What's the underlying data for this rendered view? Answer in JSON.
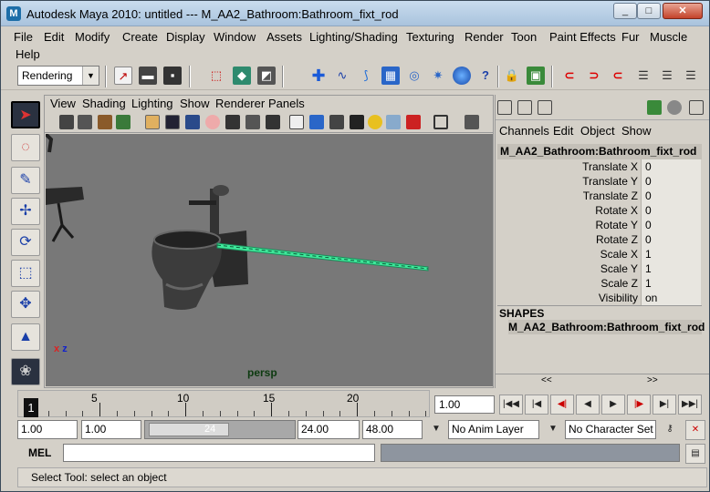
{
  "window": {
    "title": "Autodesk Maya 2010: untitled   ---   M_AA2_Bathroom:Bathroom_fixt_rod"
  },
  "menubar": {
    "items": [
      "File",
      "Edit",
      "Modify",
      "Create",
      "Display",
      "Window",
      "Assets",
      "Lighting/Shading",
      "Texturing",
      "Render",
      "Toon",
      "Paint Effects",
      "Fur",
      "Muscle",
      "Help"
    ]
  },
  "toolbar": {
    "mode": "Rendering"
  },
  "panel": {
    "menu": [
      "View",
      "Shading",
      "Lighting",
      "Show",
      "Renderer",
      "Panels"
    ],
    "camera": "persp",
    "axis_x": "x",
    "axis_z": "z"
  },
  "channelbox": {
    "menu": [
      "Channels",
      "Edit",
      "Object",
      "Show"
    ],
    "object_name": "M_AA2_Bathroom:Bathroom_fixt_rod",
    "attributes": [
      {
        "label": "Translate X",
        "value": "0"
      },
      {
        "label": "Translate Y",
        "value": "0"
      },
      {
        "label": "Translate Z",
        "value": "0"
      },
      {
        "label": "Rotate X",
        "value": "0"
      },
      {
        "label": "Rotate Y",
        "value": "0"
      },
      {
        "label": "Rotate Z",
        "value": "0"
      },
      {
        "label": "Scale X",
        "value": "1"
      },
      {
        "label": "Scale Y",
        "value": "1"
      },
      {
        "label": "Scale Z",
        "value": "1"
      },
      {
        "label": "Visibility",
        "value": "on"
      }
    ],
    "shapes_header": "SHAPES",
    "shape_name": "M_AA2_Bathroom:Bathroom_fixt_rod",
    "scroll_left": "<<",
    "scroll_right": ">>"
  },
  "timeline": {
    "current_frame": "1",
    "tick_labels": [
      "5",
      "10",
      "15",
      "20"
    ],
    "frame_field": "1.00"
  },
  "range": {
    "start": "1.00",
    "playback_start": "1.00",
    "slider_value": "24",
    "playback_end": "24.00",
    "end": "48.00",
    "anim_layer": "No Anim Layer",
    "character_set": "No Character Set"
  },
  "commandline": {
    "label": "MEL"
  },
  "status": {
    "help": "Select Tool: select an object"
  },
  "colors": {
    "selection": "#3ee89a",
    "viewport_bg": "#787878"
  }
}
